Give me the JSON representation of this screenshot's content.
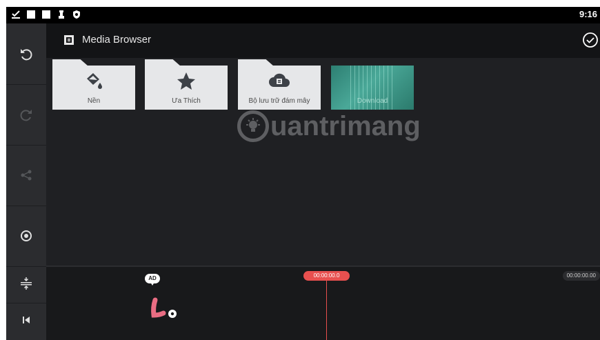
{
  "status_bar": {
    "time": "9:16",
    "icons": [
      "download-done-icon",
      "notification-icon",
      "notification-icon",
      "chess-icon",
      "shield-icon"
    ]
  },
  "sidebar": {
    "items": [
      {
        "name": "undo-icon",
        "enabled": true
      },
      {
        "name": "redo-icon",
        "enabled": false
      },
      {
        "name": "share-icon",
        "enabled": false
      },
      {
        "name": "settings-icon",
        "enabled": true
      }
    ],
    "timeline_tools": [
      "split-track-icon",
      "skip-to-start-icon"
    ]
  },
  "header": {
    "title": "Media Browser",
    "icon": "film-icon",
    "action_icon": "check-circle-icon"
  },
  "folders": [
    {
      "label": "Nền",
      "icon": "paint-bucket-icon"
    },
    {
      "label": "Ưa Thích",
      "icon": "star-icon"
    },
    {
      "label": "Bộ lưu trữ đám mây",
      "icon": "cloud-icon"
    },
    {
      "label": "Download",
      "icon": "download-thumbnail"
    }
  ],
  "watermark": {
    "text": "uantrimang"
  },
  "timeline": {
    "ad_badge": "AD",
    "playhead_time": "00:00:00.0",
    "end_time": "00:00:00.00",
    "colors": {
      "playhead": "#e8504f",
      "lo_logo": "#e96d83"
    }
  }
}
